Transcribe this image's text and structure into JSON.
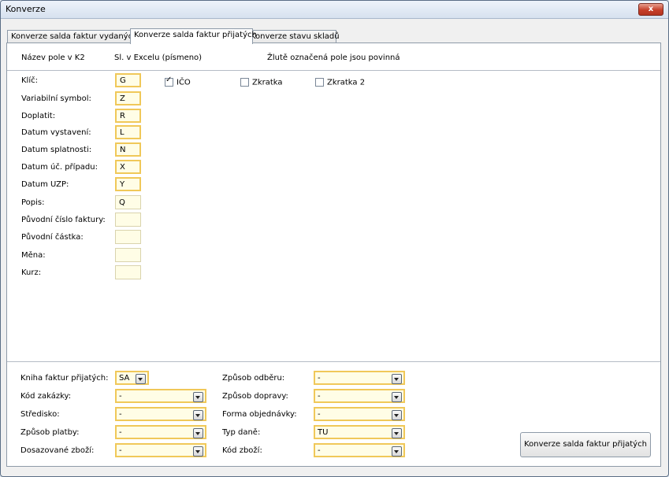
{
  "window": {
    "title": "Konverze",
    "close_label": "x"
  },
  "tabs": [
    {
      "label": "Konverze salda faktur vydaných",
      "active": false
    },
    {
      "label": "Konverze salda faktur přijatých",
      "active": true
    },
    {
      "label": "Konverze stavu skladů",
      "active": false
    }
  ],
  "header": {
    "field_name": "Název pole v K2",
    "excel_column": "Sl. v Excelu (písmeno)",
    "note": "Žlutě označená pole jsou povinná"
  },
  "fields": [
    {
      "label": "Klíč:",
      "value": "G",
      "required": true
    },
    {
      "label": "Variabilní symbol:",
      "value": "Z",
      "required": true
    },
    {
      "label": "Doplatit:",
      "value": "R",
      "required": true
    },
    {
      "label": "Datum vystavení:",
      "value": "L",
      "required": true
    },
    {
      "label": "Datum splatnosti:",
      "value": "N",
      "required": true
    },
    {
      "label": "Datum úč. případu:",
      "value": "X",
      "required": true
    },
    {
      "label": "Datum UZP:",
      "value": "Y",
      "required": true
    },
    {
      "label": "Popis:",
      "value": "Q",
      "required": false
    },
    {
      "label": "Původní číslo faktury:",
      "value": "",
      "required": false
    },
    {
      "label": "Původní částka:",
      "value": "",
      "required": false
    },
    {
      "label": "Měna:",
      "value": "",
      "required": false
    },
    {
      "label": "Kurz:",
      "value": "",
      "required": false
    }
  ],
  "key_options": [
    {
      "label": "IČO",
      "checked": true
    },
    {
      "label": "Zkratka",
      "checked": false
    },
    {
      "label": "Zkratka 2",
      "checked": false
    }
  ],
  "bottom_left": [
    {
      "label": "Kniha faktur přijatých:",
      "value": "SA"
    },
    {
      "label": "Kód zakázky:",
      "value": "-"
    },
    {
      "label": "Středisko:",
      "value": "-"
    },
    {
      "label": "Způsob platby:",
      "value": "-"
    },
    {
      "label": "Dosazované zboží:",
      "value": "-"
    }
  ],
  "bottom_right": [
    {
      "label": "Způsob odběru:",
      "value": "-"
    },
    {
      "label": "Způsob dopravy:",
      "value": "-"
    },
    {
      "label": "Forma objednávky:",
      "value": "-"
    },
    {
      "label": "Typ daně:",
      "value": "TU"
    },
    {
      "label": "Kód zboží:",
      "value": "-"
    }
  ],
  "convert_button": "Konverze salda faktur přijatých"
}
